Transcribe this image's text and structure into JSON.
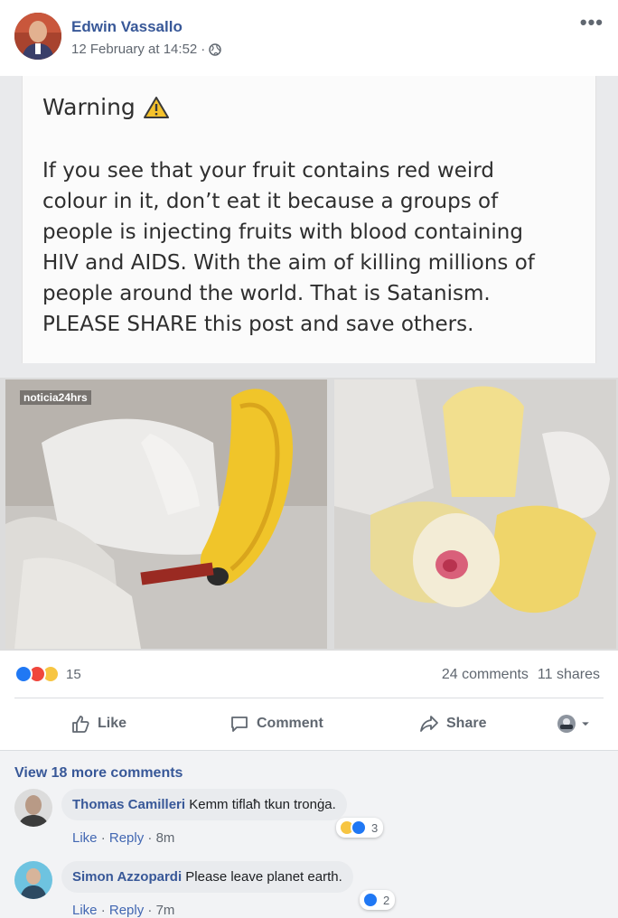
{
  "post": {
    "author": "Edwin Vassallo",
    "timestamp": "12 February at 14:52",
    "separator": "·",
    "privacy_icon": "globe-icon",
    "more_label": "•••",
    "shared_image": {
      "title": "Warning",
      "title_icon": "warning-triangle-icon",
      "lines": [
        "If you see that your fruit contains red weird",
        "colour in it, don’t eat it because a groups of",
        "people is injecting fruits with blood containing",
        "HIV and AIDS. With the aim of killing millions of",
        "people around the world. That is Satanism.",
        "PLEASE SHARE this post and save others."
      ],
      "watermark_left": "noticia24hrs"
    }
  },
  "stats": {
    "reaction_icons": [
      "like",
      "angry",
      "haha"
    ],
    "reaction_count": "15",
    "comments": "24 comments",
    "shares": "11 shares"
  },
  "actions": {
    "like": "Like",
    "comment": "Comment",
    "share": "Share"
  },
  "comments_section": {
    "view_more": "View 18 more comments",
    "items": [
      {
        "name": "Thomas Camilleri",
        "text": "Kemm tiflaħ tkun tronġa.",
        "like": "Like",
        "reply": "Reply",
        "time": "8m",
        "reactions": [
          "haha",
          "like"
        ],
        "reaction_count": "3"
      },
      {
        "name": "Simon Azzopardi",
        "text": "Please leave planet earth.",
        "like": "Like",
        "reply": "Reply",
        "time": "7m",
        "reactions": [
          "like"
        ],
        "reaction_count": "2"
      }
    ]
  },
  "colors": {
    "link": "#385898",
    "meta": "#606770",
    "like_blue": "#2078f4",
    "angry_red": "#f0463c",
    "haha_yellow": "#f7c542"
  }
}
